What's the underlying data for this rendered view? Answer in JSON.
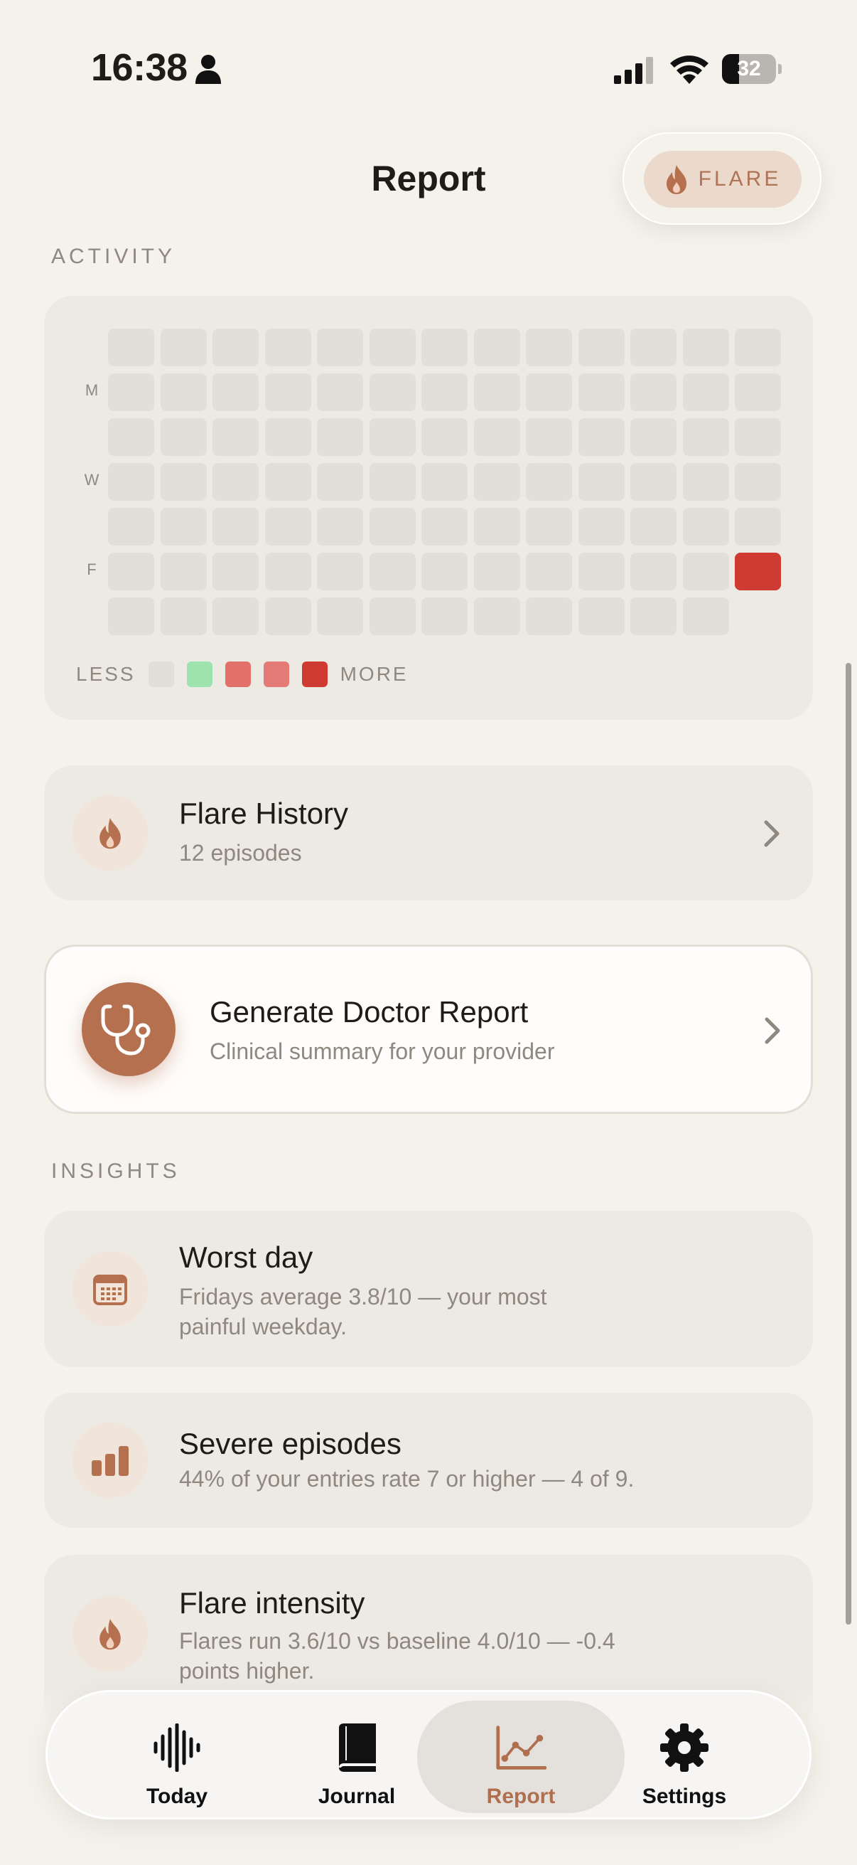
{
  "status_bar": {
    "time": "16:38",
    "battery": "32",
    "battery_level": 0.32
  },
  "header": {
    "title": "Report",
    "flare_button": "FLARE"
  },
  "activity": {
    "section_label": "ACTIVITY",
    "day_labels": [
      "M",
      "W",
      "F"
    ],
    "weeks": 13,
    "highlight": {
      "week": 13,
      "day": "F",
      "level": 4
    },
    "legend": {
      "less": "LESS",
      "more": "MORE",
      "colors": [
        "#E2DFDA",
        "#9EE3AE",
        "#E2706B",
        "#E57B76",
        "#CF3A32"
      ]
    }
  },
  "flare_history": {
    "title": "Flare History",
    "subtitle": "12 episodes"
  },
  "doctor_report": {
    "title": "Generate Doctor Report",
    "subtitle": "Clinical summary for your provider"
  },
  "insights": {
    "section_label": "INSIGHTS",
    "items": [
      {
        "icon": "calendar-icon",
        "title": "Worst day",
        "line1": "Fridays average 3.8/10 — your most",
        "line2": "painful weekday."
      },
      {
        "icon": "bar-chart-icon",
        "title": "Severe episodes",
        "line1": "44% of your entries rate 7 or higher — 4 of 9.",
        "line2": ""
      },
      {
        "icon": "flame-icon",
        "title": "Flare intensity",
        "line1": "Flares run 3.6/10 vs baseline 4.0/10 — -0.4",
        "line2": "points higher."
      }
    ]
  },
  "tabs": [
    {
      "label": "Today",
      "icon": "waveform-icon",
      "active": false
    },
    {
      "label": "Journal",
      "icon": "book-icon",
      "active": false
    },
    {
      "label": "Report",
      "icon": "line-chart-icon",
      "active": true
    },
    {
      "label": "Settings",
      "icon": "gear-icon",
      "active": false
    }
  ],
  "colors": {
    "accent": "#B5714F",
    "background": "#F5F2EC",
    "card": "#EDEAE4",
    "cell_empty": "#E2DFDA",
    "cell_high": "#CF3A32"
  }
}
